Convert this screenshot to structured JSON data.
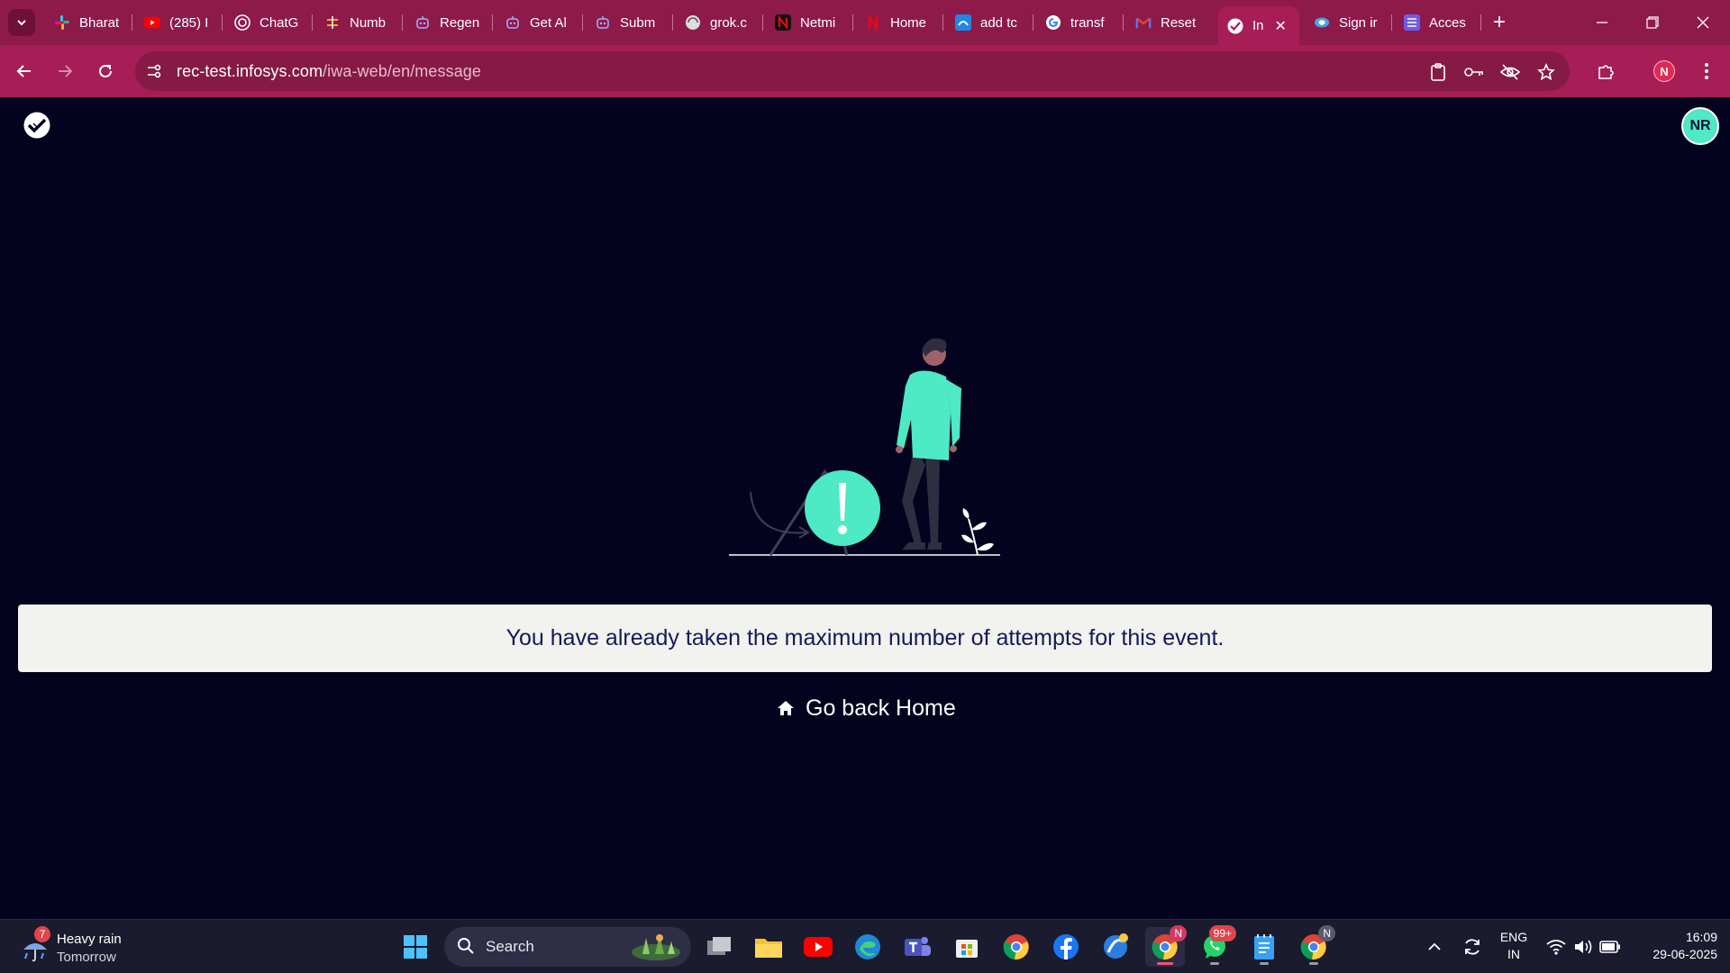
{
  "browser": {
    "tabs": [
      {
        "label": "Bharat",
        "icon": "slack-icon"
      },
      {
        "label": "(285) I",
        "icon": "youtube-icon"
      },
      {
        "label": "ChatG",
        "icon": "chatgpt-icon"
      },
      {
        "label": "Numb",
        "icon": "numbers-icon"
      },
      {
        "label": "Regen",
        "icon": "robot-icon"
      },
      {
        "label": "Get Al",
        "icon": "robot-icon"
      },
      {
        "label": "Subm",
        "icon": "robot-icon"
      },
      {
        "label": "grok.c",
        "icon": "globe-icon"
      },
      {
        "label": "Netmi",
        "icon": "netmirror-icon"
      },
      {
        "label": "Home",
        "icon": "netflix-icon"
      },
      {
        "label": "add tc",
        "icon": "azure-icon"
      },
      {
        "label": "transf",
        "icon": "google-icon"
      },
      {
        "label": "Reset",
        "icon": "gmail-icon"
      },
      {
        "label": "In",
        "icon": "infosys-wingspan-icon",
        "active": true
      },
      {
        "label": "Sign ir",
        "icon": "signin-icon"
      },
      {
        "label": "Acces",
        "icon": "list-icon"
      }
    ],
    "url_domain": "rec-test.infosys.com",
    "url_path": "/iwa-web/en/message",
    "profile_initial": "N"
  },
  "page": {
    "user_initials": "NR",
    "message": "You have already taken the maximum number of attempts for this event.",
    "home_link": "Go back Home",
    "accent_color": "#4ee9c5",
    "background_color": "#03031f"
  },
  "taskbar": {
    "weather_title": "Heavy rain",
    "weather_sub": "Tomorrow",
    "weather_badge": "7",
    "search_label": "Search",
    "whatsapp_badge": "99+",
    "chrome_badge": "N",
    "lang_line1": "ENG",
    "lang_line2": "IN",
    "time": "16:09",
    "date": "29-06-2025"
  }
}
